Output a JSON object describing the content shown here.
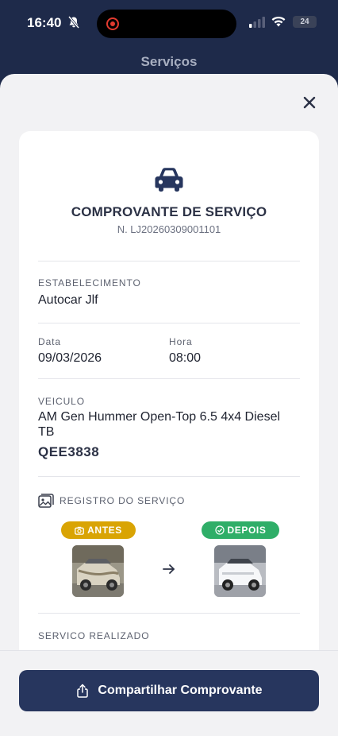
{
  "status_bar": {
    "time": "16:40",
    "battery": "24"
  },
  "header": {
    "title": "Serviços"
  },
  "receipt": {
    "title": "COMPROVANTE DE SERVIÇO",
    "number": "N. LJ20260309001101",
    "establishment_label": "ESTABELECIMENTO",
    "establishment": "Autocar Jlf",
    "date_label": "Data",
    "date": "09/03/2026",
    "time_label": "Hora",
    "time": "08:00",
    "vehicle_label": "VEICULO",
    "vehicle_line1": "AM Gen Hummer Open-Top 6.5 4x4 Diesel",
    "vehicle_line2": "TB",
    "plate": "QEE3838",
    "record_label": "REGISTRO DO SERVIÇO",
    "before_label": "ANTES",
    "after_label": "DEPOIS",
    "service_label": "SERVICO REALIZADO"
  },
  "actions": {
    "share_label": "Compartilhar Comprovante"
  },
  "colors": {
    "navy": "#27365e",
    "before": "#d9a404",
    "after": "#2fae68"
  },
  "icons": [
    "bell-off-icon",
    "signal-icon",
    "wifi-icon",
    "close-icon",
    "car-icon",
    "gallery-icon",
    "camera-icon",
    "check-circle-icon",
    "arrow-right-icon",
    "share-icon"
  ]
}
